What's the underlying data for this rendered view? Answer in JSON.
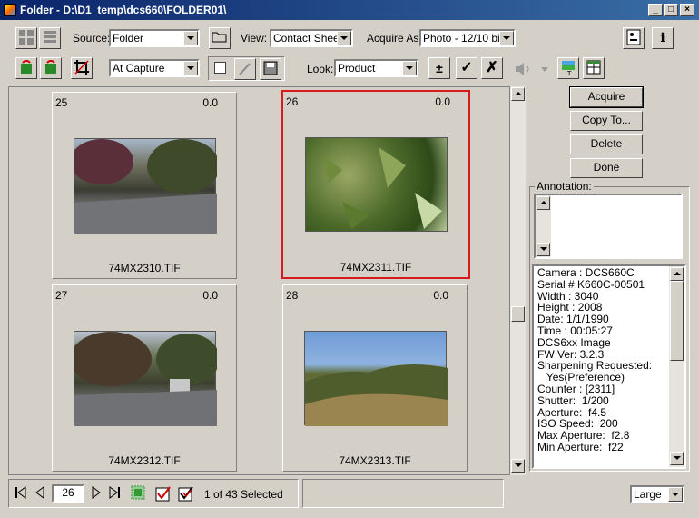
{
  "window": {
    "title": "Folder - D:\\D1_temp\\dcs660\\FOLDER01\\",
    "minimize": "_",
    "maximize": "□",
    "close": "×"
  },
  "toolbar1": {
    "source_label": "Source:",
    "source_value": "Folder",
    "view_label": "View:",
    "view_value": "Contact Sheet",
    "acquire_as_label": "Acquire As:",
    "acquire_as_value": "Photo - 12/10 bit"
  },
  "toolbar2": {
    "capture_value": "At Capture",
    "look_label": "Look:",
    "look_value": "Product"
  },
  "thumbnails": [
    {
      "number": "25",
      "rating": "0.0",
      "filename": "74MX2310.TIF",
      "selected": false
    },
    {
      "number": "26",
      "rating": "0.0",
      "filename": "74MX2311.TIF",
      "selected": true
    },
    {
      "number": "27",
      "rating": "0.0",
      "filename": "74MX2312.TIF",
      "selected": false
    },
    {
      "number": "28",
      "rating": "0.0",
      "filename": "74MX2313.TIF",
      "selected": false
    }
  ],
  "buttons": {
    "acquire": "Acquire",
    "copy_to": "Copy To...",
    "delete": "Delete",
    "done": "Done"
  },
  "annotation_label": "Annotation:",
  "info_lines": [
    "Camera : DCS660C",
    "Serial #:K660C-00501",
    "Width : 3040",
    "Height : 2008",
    "Date: 1/1/1990",
    "Time : 00:05:27",
    "DCS6xx Image",
    "FW Ver: 3.2.3",
    "Sharpening Requested:",
    "   Yes(Preference)",
    "Counter : [2311]",
    "Shutter:  1/200",
    "Aperture:  f4.5",
    "ISO Speed:  200",
    "Max Aperture:  f2.8",
    "Min Aperture:  f22"
  ],
  "status": {
    "page_number": "26",
    "selected_text": "1 of 43 Selected",
    "size_value": "Large"
  },
  "colors": {
    "selection_border": "#d91a1a",
    "titlebar": "#0a246a"
  }
}
